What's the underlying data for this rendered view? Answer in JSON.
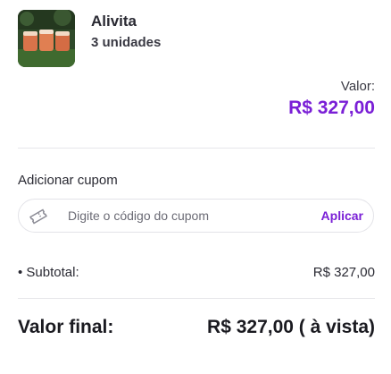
{
  "product": {
    "name": "Alivita",
    "quantity": "3 unidades"
  },
  "price": {
    "label": "Valor:",
    "value": "R$ 327,00"
  },
  "coupon": {
    "title": "Adicionar cupom",
    "placeholder": "Digite o código do cupom",
    "apply_label": "Aplicar"
  },
  "summary": {
    "subtotal_label": "• Subtotal:",
    "subtotal_value": "R$ 327,00",
    "final_label": "Valor final:",
    "final_value": "R$ 327,00 ( à vista)"
  },
  "colors": {
    "accent": "#7a1fd6",
    "text": "#1f1f24",
    "divider": "#e6e6ea"
  }
}
